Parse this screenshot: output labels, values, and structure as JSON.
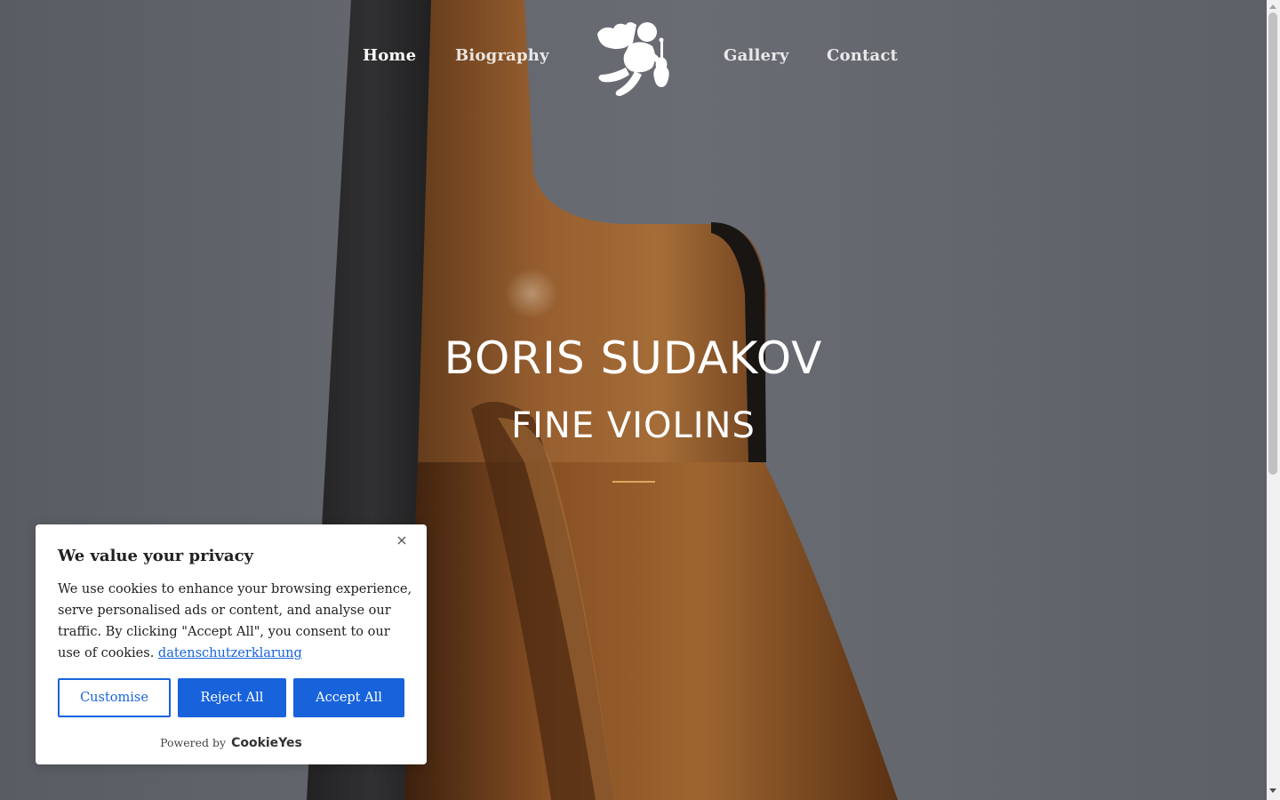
{
  "nav": {
    "items": [
      {
        "label": "Home",
        "active": true
      },
      {
        "label": "Biography",
        "active": false
      },
      {
        "label": "Gallery",
        "active": false
      },
      {
        "label": "Contact",
        "active": false
      }
    ],
    "logo_icon": "cherub-violin-icon"
  },
  "hero": {
    "title": "BORIS SUDAKOV",
    "subtitle": "FINE VIOLINS",
    "divider_color": "#d9a85f"
  },
  "cookie_banner": {
    "title": "We value your privacy",
    "description": "We use cookies to enhance your browsing experience, serve personalised ads or content, and analyse our traffic. By clicking \"Accept All\", you consent to our use of cookies.",
    "link_text": "datenschutzerklarung",
    "buttons": {
      "customise": "Customise",
      "reject": "Reject All",
      "accept": "Accept All"
    },
    "powered_by": "Powered by",
    "brand": "CookieYes",
    "accent_color": "#1863dc"
  }
}
